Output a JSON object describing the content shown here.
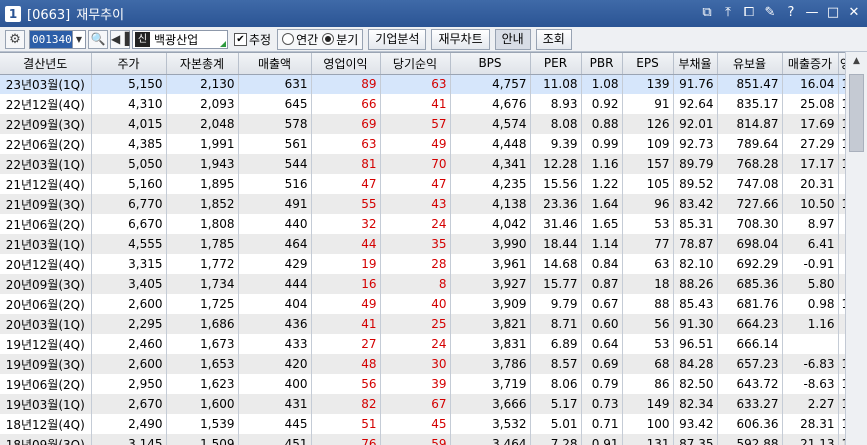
{
  "window": {
    "number": "1",
    "code": "[0663]",
    "title": "재무추이",
    "buttons": [
      "⧉",
      "⤒",
      "⧠",
      "✎",
      "?",
      "—",
      "□",
      "✕"
    ]
  },
  "toolbar": {
    "gear": "⚙",
    "stock_code": "001340",
    "dropdown": "▼",
    "search": "🔍",
    "sound": "◀▐",
    "name_badge": "신",
    "stock_name": "백광산업",
    "adjust_label": "추정",
    "adjust_checked": "✔",
    "radio_year": "연간",
    "radio_quarter": "분기",
    "btn_company": "기업분석",
    "btn_chart": "재무차트",
    "btn_guide": "안내",
    "btn_query": "조회"
  },
  "table": {
    "headers": [
      "결산년도",
      "주가",
      "자본총계",
      "매출액",
      "영업이익",
      "당기순익",
      "BPS",
      "PER",
      "PBR",
      "EPS",
      "부채율",
      "유보율",
      "매출증가",
      "영익률"
    ],
    "rows": [
      [
        "23년03월(1Q)",
        "5,150",
        "2,130",
        "631",
        "89",
        "63",
        "4,757",
        "11.08",
        "1.08",
        "139",
        "91.76",
        "851.47",
        "16.04",
        "14.13"
      ],
      [
        "22년12월(4Q)",
        "4,310",
        "2,093",
        "645",
        "66",
        "41",
        "4,676",
        "8.93",
        "0.92",
        "91",
        "92.64",
        "835.17",
        "25.08",
        "10.18"
      ],
      [
        "22년09월(3Q)",
        "4,015",
        "2,048",
        "578",
        "69",
        "57",
        "4,574",
        "8.08",
        "0.88",
        "126",
        "92.01",
        "814.87",
        "17.69",
        "12.01"
      ],
      [
        "22년06월(2Q)",
        "4,385",
        "1,991",
        "561",
        "63",
        "49",
        "4,448",
        "9.39",
        "0.99",
        "109",
        "92.73",
        "789.64",
        "27.29",
        "11.24"
      ],
      [
        "22년03월(1Q)",
        "5,050",
        "1,943",
        "544",
        "81",
        "70",
        "4,341",
        "12.28",
        "1.16",
        "157",
        "89.79",
        "768.28",
        "17.17",
        "14.86"
      ],
      [
        "21년12월(4Q)",
        "5,160",
        "1,895",
        "516",
        "47",
        "47",
        "4,235",
        "15.56",
        "1.22",
        "105",
        "89.52",
        "747.08",
        "20.31",
        "9.19"
      ],
      [
        "21년09월(3Q)",
        "6,770",
        "1,852",
        "491",
        "55",
        "43",
        "4,138",
        "23.36",
        "1.64",
        "96",
        "83.42",
        "727.66",
        "10.50",
        "11.28"
      ],
      [
        "21년06월(2Q)",
        "6,670",
        "1,808",
        "440",
        "32",
        "24",
        "4,042",
        "31.46",
        "1.65",
        "53",
        "85.31",
        "708.30",
        "8.97",
        "7.28"
      ],
      [
        "21년03월(1Q)",
        "4,555",
        "1,785",
        "464",
        "44",
        "35",
        "3,990",
        "18.44",
        "1.14",
        "77",
        "78.87",
        "698.04",
        "6.41",
        "9.59"
      ],
      [
        "20년12월(4Q)",
        "3,315",
        "1,772",
        "429",
        "19",
        "28",
        "3,961",
        "14.68",
        "0.84",
        "63",
        "82.10",
        "692.29",
        "-0.91",
        "4.47"
      ],
      [
        "20년09월(3Q)",
        "3,405",
        "1,734",
        "444",
        "16",
        "8",
        "3,927",
        "15.77",
        "0.87",
        "18",
        "88.26",
        "685.36",
        "5.80",
        "3.70"
      ],
      [
        "20년06월(2Q)",
        "2,600",
        "1,725",
        "404",
        "49",
        "40",
        "3,909",
        "9.79",
        "0.67",
        "88",
        "85.43",
        "681.76",
        "0.98",
        "12.15"
      ],
      [
        "20년03월(1Q)",
        "2,295",
        "1,686",
        "436",
        "41",
        "25",
        "3,821",
        "8.71",
        "0.60",
        "56",
        "91.30",
        "664.23",
        "1.16",
        "9.29"
      ],
      [
        "19년12월(4Q)",
        "2,460",
        "1,673",
        "433",
        "27",
        "24",
        "3,831",
        "6.89",
        "0.64",
        "53",
        "96.51",
        "666.14",
        "",
        "6.20"
      ],
      [
        "19년09월(3Q)",
        "2,600",
        "1,653",
        "420",
        "48",
        "30",
        "3,786",
        "8.57",
        "0.69",
        "68",
        "84.28",
        "657.23",
        "-6.83",
        "11.39"
      ],
      [
        "19년06월(2Q)",
        "2,950",
        "1,623",
        "400",
        "56",
        "39",
        "3,719",
        "8.06",
        "0.79",
        "86",
        "82.50",
        "643.72",
        "-8.63",
        "13.87"
      ],
      [
        "19년03월(1Q)",
        "2,670",
        "1,600",
        "431",
        "82",
        "67",
        "3,666",
        "5.17",
        "0.73",
        "149",
        "82.34",
        "633.27",
        "2.27",
        "18.99"
      ],
      [
        "18년12월(4Q)",
        "2,490",
        "1,539",
        "445",
        "51",
        "45",
        "3,532",
        "5.01",
        "0.71",
        "100",
        "93.42",
        "606.36",
        "28.31",
        "11.41"
      ],
      [
        "18년09월(3Q)",
        "3,145",
        "1,509",
        "451",
        "76",
        "59",
        "3,464",
        "7.28",
        "0.91",
        "131",
        "87.35",
        "592.88",
        "21.13",
        "16.87"
      ]
    ]
  },
  "colors": {
    "profit": "#d40000",
    "accent": "#2b5494"
  }
}
